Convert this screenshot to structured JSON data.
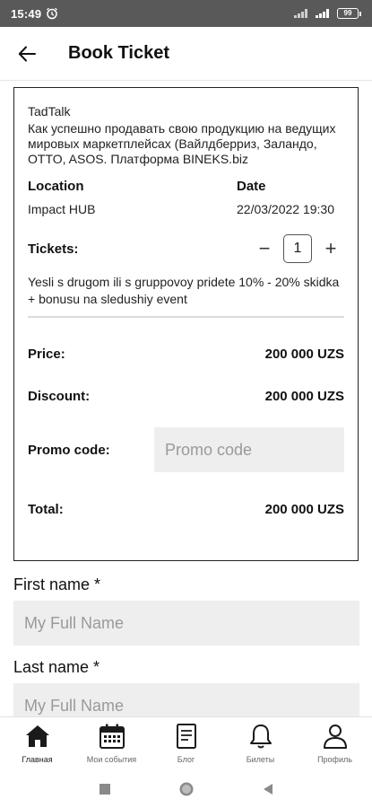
{
  "status_bar": {
    "time": "15:49",
    "battery": "99"
  },
  "header": {
    "title": "Book Ticket"
  },
  "event": {
    "organizer": "TadTalk",
    "description": "Как успешно продавать свою  продукцию на ведущих мировых маркетплейсах (Вайлдберриз, Заландо, OTTO, ASOS. Платформа BINEKS.biz",
    "location_label": "Location",
    "location_value": "Impact HUB",
    "date_label": "Date",
    "date_value": "22/03/2022 19:30"
  },
  "tickets": {
    "label": "Tickets:",
    "quantity": "1",
    "minus": "−",
    "plus": "+",
    "discount_note": "Yesli s drugom ili s gruppovoy pridete 10% - 20% skidka + bonusu na sledushiy event"
  },
  "pricing": {
    "price_label": "Price:",
    "price_value": "200 000 UZS",
    "discount_label": "Discount:",
    "discount_value": "200 000 UZS",
    "promo_label": "Promo code:",
    "promo_placeholder": "Promo code",
    "total_label": "Total:",
    "total_value": "200 000 UZS"
  },
  "form": {
    "first_name_label": "First name *",
    "first_name_placeholder": "My Full Name",
    "last_name_label": "Last name *",
    "last_name_placeholder": "My Full Name"
  },
  "bottom_nav": [
    {
      "label": "Главная",
      "icon": "home-icon",
      "active": true
    },
    {
      "label": "Мои события",
      "icon": "calendar-icon",
      "active": false
    },
    {
      "label": "Блог",
      "icon": "document-icon",
      "active": false
    },
    {
      "label": "Билеты",
      "icon": "bell-icon",
      "active": false
    },
    {
      "label": "Профиль",
      "icon": "person-icon",
      "active": false
    }
  ]
}
